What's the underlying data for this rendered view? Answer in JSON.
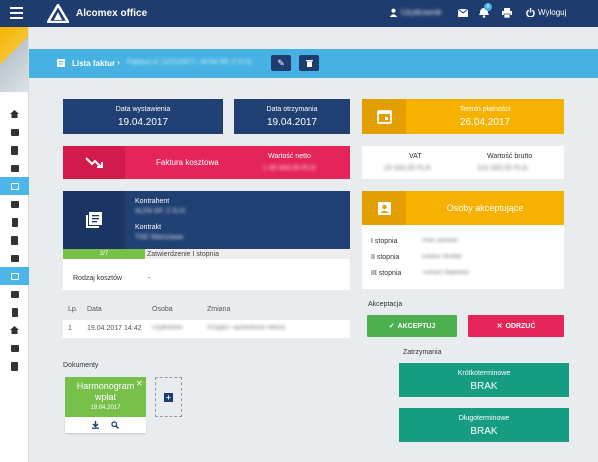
{
  "header": {
    "app_title": "Alcomex office",
    "user_name": "Użytkownik",
    "notification_count": "0",
    "logout_label": "Wyloguj",
    "colors": {
      "navy": "#1f3c6e",
      "accent": "#45b2e3"
    }
  },
  "breadcrumb": {
    "list_label": "Lista faktur",
    "current": "Faktura nr 11/11/2017 - ALFA SP. Z O.O."
  },
  "dates": {
    "issue_label": "Data wystawienia",
    "issue_value": "19.04.2017",
    "received_label": "Data otrzymania",
    "received_value": "19.04.2017",
    "due_label": "Termin płatności",
    "due_value": "26.04.2017"
  },
  "invoice": {
    "type_label": "Faktura kosztowa",
    "net_label": "Wartość netto",
    "net_value": "1 00 000,00 PLN",
    "vat_label": "VAT",
    "vat_value": "24 000,00 PLN",
    "gross_label": "Wartość brutto",
    "gross_value": "102 000,00 PLN"
  },
  "contractor": {
    "contractor_label": "Kontrahent",
    "contractor_value": "ALFA SP. Z O.O.",
    "contract_label": "Kontrakt",
    "contract_value": "TSE Warszawa",
    "progress_label": "2/7",
    "progress_fraction": 0.2857,
    "status_text": "Zatwierdzenie I stopnia",
    "cost_type_label": "Rodzaj kosztów",
    "cost_type_value": "-"
  },
  "approvers": {
    "title": "Osoby akceptujące",
    "rows": [
      {
        "level": "I stopnia",
        "name": "Piotr Jasiński"
      },
      {
        "level": "II stopnia",
        "name": "Łukasz Wróbel"
      },
      {
        "level": "III stopnia",
        "name": "Tomasz Malewski"
      }
    ]
  },
  "history": {
    "headers": {
      "lp": "Lp.",
      "date": "Data",
      "person": "Osoba",
      "change": "Zmiana"
    },
    "rows": [
      {
        "lp": "1",
        "date": "19.04.2017 14:42",
        "person": "Użytkownik",
        "change": "Przyjęto i sprawdzono faktury"
      }
    ]
  },
  "acceptance": {
    "title": "Akceptacja",
    "accept_label": "AKCEPTUJ",
    "reject_label": "ODRZUĆ"
  },
  "documents": {
    "title": "Dokumenty",
    "items": [
      {
        "name": "Harmonogram wpłat",
        "date": "19.04.2017"
      }
    ]
  },
  "holds": {
    "title": "Zatrzymania",
    "short_label": "Krótkoterminowe",
    "short_value": "BRAK",
    "long_label": "Długoterminowe",
    "long_value": "BRAK"
  }
}
